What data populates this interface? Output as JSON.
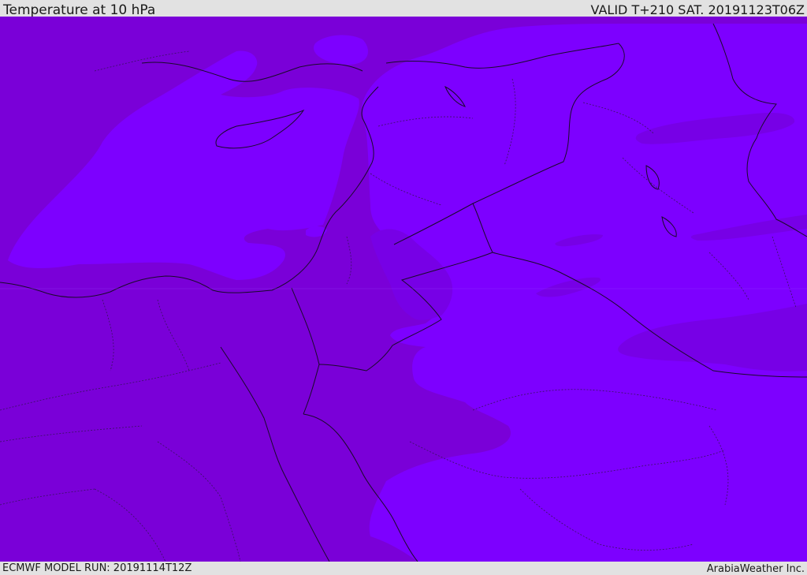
{
  "header": {
    "title": "Temperature at 10 hPa",
    "valid": "VALID T+210 SAT. 20191123T06Z"
  },
  "footer": {
    "model_run": "ECMWF MODEL RUN: 20191114T12Z",
    "credit": "ArabiaWeather Inc."
  },
  "map": {
    "colors": {
      "warm_band": "#7a00d8",
      "cool_band": "#7d00ff",
      "warmest_band": "#7400cc",
      "coastline": "#1a0a2a",
      "borders": "#2b0a4a"
    }
  }
}
